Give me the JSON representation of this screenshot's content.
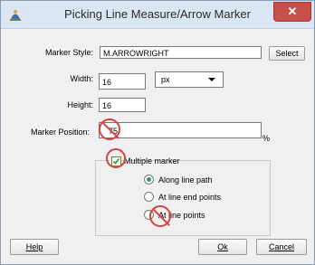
{
  "window": {
    "title": "Picking Line Measure/Arrow Marker",
    "close_glyph": "✕",
    "icon": "app-icon"
  },
  "marker_style": {
    "label": "Marker Style:",
    "value": "M.ARROWRIGHT",
    "select_label": "Select"
  },
  "width": {
    "label": "Width:",
    "value": "16",
    "unit_selected": "px"
  },
  "height": {
    "label": "Height:",
    "value": "16"
  },
  "marker_position": {
    "label": "Marker Position:",
    "value": "75",
    "unit": "%"
  },
  "multiple": {
    "checkbox_label": "Multiple marker",
    "checked": true,
    "options": [
      {
        "label": "Along line path",
        "selected": true
      },
      {
        "label": "At line end points",
        "selected": false
      },
      {
        "label": "At line points",
        "selected": false
      }
    ]
  },
  "buttons": {
    "help": "Help",
    "ok": "Ok",
    "cancel": "Cancel"
  },
  "annotation_color": "#d2453f"
}
